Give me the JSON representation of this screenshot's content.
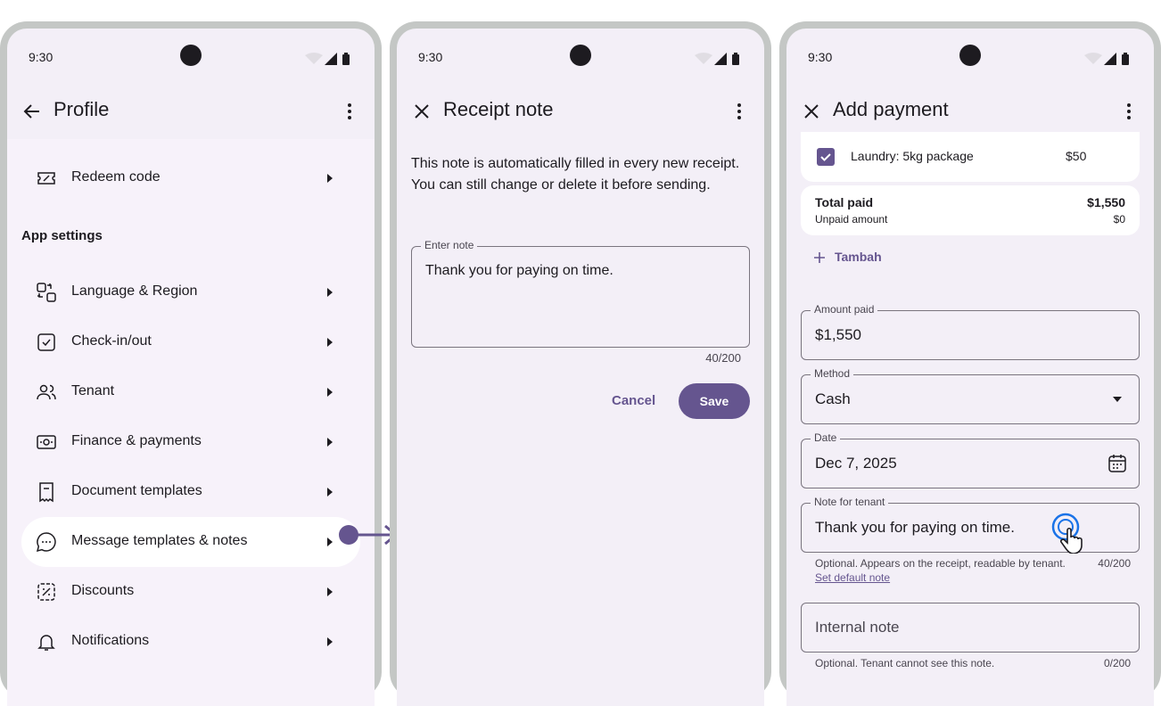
{
  "status": {
    "time": "9:30"
  },
  "screen1": {
    "title": "Profile",
    "items_top": [
      {
        "label": "Redeem code",
        "icon": "ticket-icon"
      }
    ],
    "section_header": "App settings",
    "items": [
      {
        "label": "Language & Region",
        "icon": "globe-grid-icon"
      },
      {
        "label": "Check-in/out",
        "icon": "calendar-check-icon"
      },
      {
        "label": "Tenant",
        "icon": "people-icon"
      },
      {
        "label": "Finance & payments",
        "icon": "money-icon"
      },
      {
        "label": "Document templates",
        "icon": "receipt-icon"
      },
      {
        "label": "Message templates & notes",
        "icon": "chat-bubble-icon"
      },
      {
        "label": "Discounts",
        "icon": "discount-tag-icon"
      },
      {
        "label": "Notifications",
        "icon": "bell-icon"
      }
    ]
  },
  "screen2": {
    "title": "Receipt note",
    "description": "This note is automatically filled in every new receipt. You can still change or delete it before sending.",
    "field_label": "Enter note",
    "field_value": "Thank you for paying on time.",
    "counter": "40/200",
    "cancel": "Cancel",
    "save": "Save"
  },
  "screen3": {
    "title": "Add payment",
    "line_item": {
      "label": "Laundry: 5kg package",
      "amount": "$50",
      "checked": true
    },
    "total_paid_label": "Total paid",
    "total_paid_value": "$1,550",
    "unpaid_label": "Unpaid amount",
    "unpaid_value": "$0",
    "add_label": "Tambah",
    "amount_label": "Amount paid",
    "amount_value": "$1,550",
    "method_label": "Method",
    "method_value": "Cash",
    "date_label": "Date",
    "date_value": "Dec 7, 2025",
    "note_label": "Note for tenant",
    "note_value": "Thank you for paying on time.",
    "note_helper": "Optional. Appears on the receipt, readable by tenant.",
    "note_counter": "40/200",
    "set_default": "Set default note",
    "internal_placeholder": "Internal note",
    "internal_helper": "Optional. Tenant cannot see this note.",
    "internal_counter": "0/200"
  },
  "colors": {
    "accent": "#65558f",
    "surface": "#f3eff7",
    "frame": "#c4c7c5"
  }
}
